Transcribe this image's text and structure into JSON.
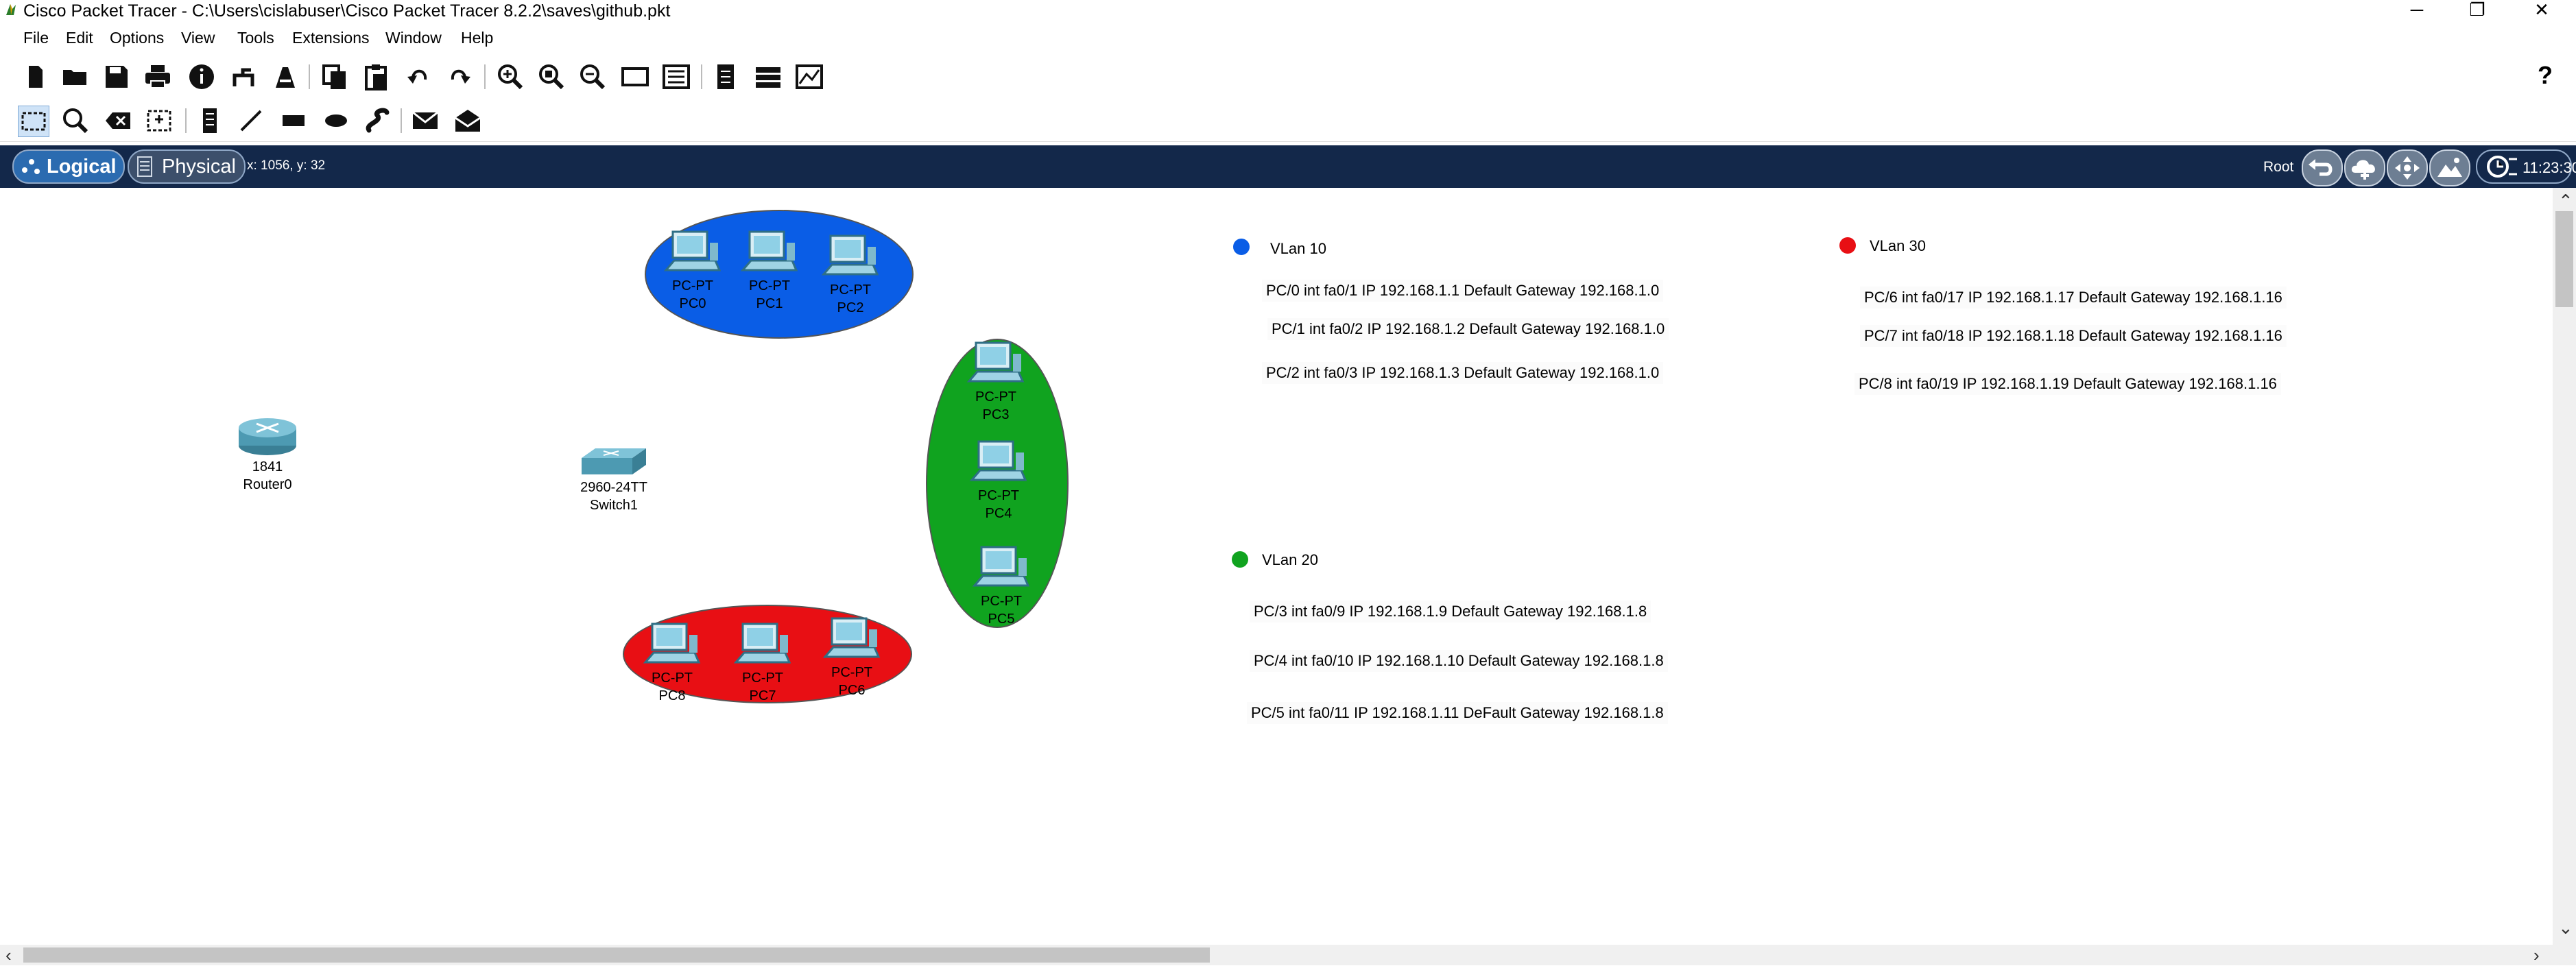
{
  "app": {
    "title": "Cisco Packet Tracer - C:\\Users\\cislabuser\\Cisco Packet Tracer 8.2.2\\saves\\github.pkt",
    "window_controls": {
      "minimize": "─",
      "restore": "❐",
      "close": "✕"
    }
  },
  "menu": [
    "File",
    "Edit",
    "Options",
    "View",
    "Tools",
    "Extensions",
    "Window",
    "Help"
  ],
  "toolbar": {
    "main_icons": [
      "new-file-icon",
      "open-folder-icon",
      "save-icon",
      "print-icon",
      "info-icon",
      "network-wizard-icon",
      "activity-wizard-icon",
      "copy-icon",
      "paste-icon",
      "undo-icon",
      "redo-icon",
      "zoom-in-icon",
      "zoom-reset-icon",
      "zoom-out-icon",
      "rectangle-view-icon",
      "custom-device-icon",
      "note-icon",
      "palette-icon",
      "viewport-icon"
    ],
    "help_label": "?"
  },
  "tools": [
    "select-icon",
    "inspect-icon",
    "delete-icon",
    "resize-shape-icon",
    "note-tool-icon",
    "line-draw-icon",
    "rectangle-draw-icon",
    "ellipse-draw-icon",
    "freeform-draw-icon",
    "add-simple-pdu-icon",
    "add-complex-pdu-icon"
  ],
  "modebar": {
    "logical_label": "Logical",
    "physical_label": "Physical",
    "coords": "x: 1056, y: 32",
    "root_label": "Root",
    "time": "11:23:30"
  },
  "colors": {
    "vlan10": "#0a5de6",
    "vlan20": "#10a31f",
    "vlan30": "#e80f14",
    "modebar": "#13284a"
  },
  "devices": {
    "router": {
      "model": "1841",
      "name": "Router0"
    },
    "switch": {
      "model": "2960-24TT",
      "name": "Switch1"
    },
    "pcs": [
      {
        "type": "PC-PT",
        "name": "PC0"
      },
      {
        "type": "PC-PT",
        "name": "PC1"
      },
      {
        "type": "PC-PT",
        "name": "PC2"
      },
      {
        "type": "PC-PT",
        "name": "PC3"
      },
      {
        "type": "PC-PT",
        "name": "PC4"
      },
      {
        "type": "PC-PT",
        "name": "PC5"
      },
      {
        "type": "PC-PT",
        "name": "PC8"
      },
      {
        "type": "PC-PT",
        "name": "PC7"
      },
      {
        "type": "PC-PT",
        "name": "PC6"
      }
    ]
  },
  "vlans": {
    "vlan10": {
      "title": "VLan 10",
      "lines": [
        "PC/0 int fa0/1 IP 192.168.1.1 Default Gateway 192.168.1.0",
        "PC/1 int fa0/2 IP 192.168.1.2 Default Gateway 192.168.1.0",
        "PC/2 int fa0/3 IP 192.168.1.3 Default Gateway 192.168.1.0"
      ]
    },
    "vlan20": {
      "title": "VLan 20",
      "lines": [
        "PC/3 int fa0/9 IP 192.168.1.9 Default Gateway 192.168.1.8",
        "PC/4 int fa0/10 IP 192.168.1.10 Default Gateway 192.168.1.8",
        "PC/5 int fa0/11 IP 192.168.1.11 DeFault Gateway 192.168.1.8"
      ]
    },
    "vlan30": {
      "title": "VLan 30",
      "lines": [
        "PC/6 int fa0/17 IP 192.168.1.17 Default Gateway 192.168.1.16",
        "PC/7 int fa0/18 IP 192.168.1.18 Default Gateway 192.168.1.16",
        "PC/8 int fa0/19 IP 192.168.1.19 Default Gateway 192.168.1.16"
      ]
    }
  }
}
